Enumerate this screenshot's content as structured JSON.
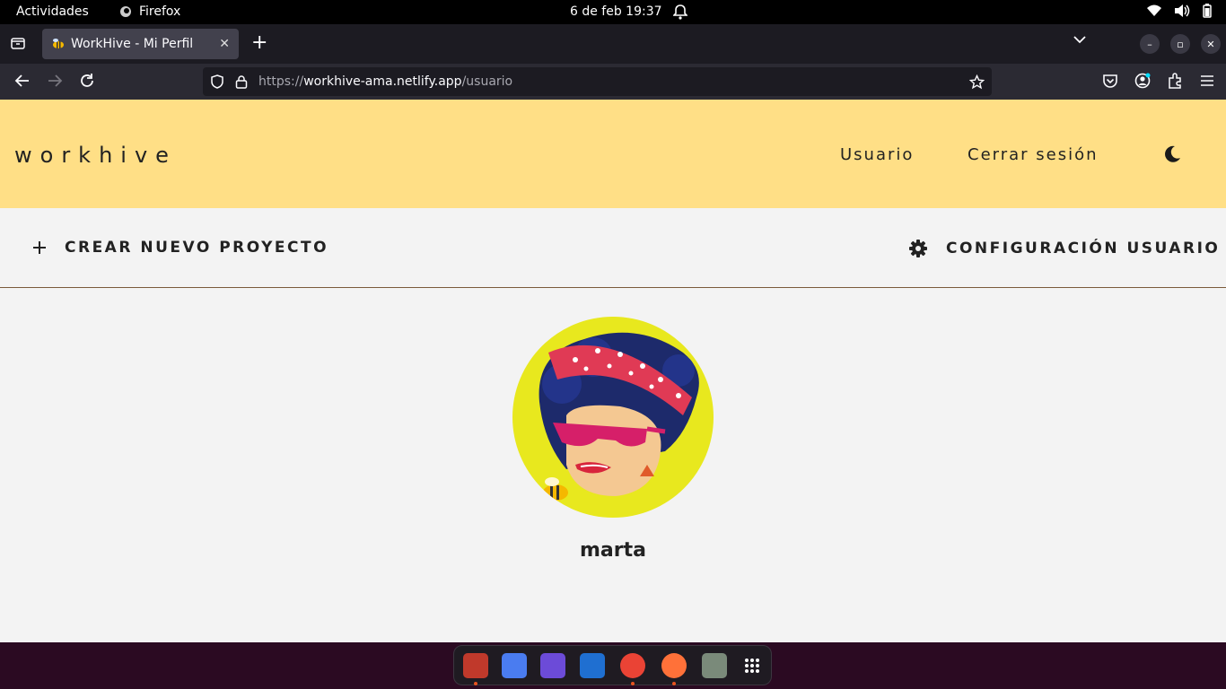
{
  "topbar": {
    "activities": "Actividades",
    "app_name": "Firefox",
    "datetime": "6 de feb  19:37"
  },
  "browser": {
    "tab_title": "WorkHive - Mi Perfil",
    "url_prefix": "https://",
    "url_host": "workhive-ama.netlify.app",
    "url_path": "/usuario"
  },
  "site": {
    "logo": "workhive",
    "nav": [
      "Usuario",
      "Cerrar sesión"
    ],
    "actions": {
      "create": "CREAR NUEVO PROYECTO",
      "settings": "CONFIGURACIÓN USUARIO"
    },
    "username": "marta"
  },
  "colors": {
    "header_bg": "#ffdf86",
    "page_bg": "#f3f3f3",
    "avatar_bg": "#e8e81e",
    "accent": "#e95420"
  }
}
